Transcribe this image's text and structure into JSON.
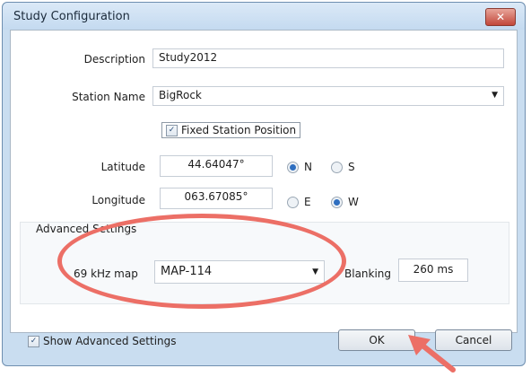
{
  "window": {
    "title": "Study Configuration",
    "close_glyph": "✕"
  },
  "form": {
    "description_label": "Description",
    "description_value": "Study2012",
    "station_label": "Station Name",
    "station_value": "BigRock",
    "fixed_position_label": "Fixed Station Position",
    "fixed_position_checked": true,
    "latitude_label": "Latitude",
    "latitude_value": "44.64047°",
    "latitude_options": [
      "N",
      "S"
    ],
    "latitude_selected": "N",
    "longitude_label": "Longitude",
    "longitude_value": "063.67085°",
    "longitude_options": [
      "E",
      "W"
    ],
    "longitude_selected": "W"
  },
  "advanced": {
    "group_label": "Advanced Settings",
    "map_label": "69 kHz map",
    "map_value": "MAP-114",
    "blanking_label": "Blanking",
    "blanking_value": "260 ms"
  },
  "footer": {
    "show_advanced_label": "Show Advanced Settings",
    "show_advanced_checked": true,
    "ok_label": "OK",
    "cancel_label": "Cancel"
  },
  "colors": {
    "annotation": "#ec6f66",
    "window_frame": "#c9ddf0",
    "radio_selected": "#2f6fc0"
  },
  "icons": {
    "dropdown": "chevron-down-icon",
    "check": "checkmark-icon",
    "close": "close-icon",
    "annotation_arrow": "pointer-arrow-icon"
  }
}
